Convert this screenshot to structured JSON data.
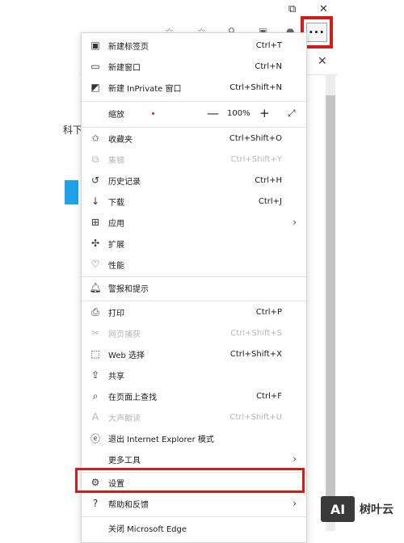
{
  "window_controls": {
    "restore": "⧉",
    "close": "✕"
  },
  "tab": {
    "close": "✕"
  },
  "toolbar": {
    "more_button": "···",
    "icons": [
      "star-icon",
      "favorites-icon",
      "extensions-icon",
      "collections-icon",
      "profile-icon"
    ],
    "icon_glyphs": [
      "☆",
      "☆",
      "⚲",
      "▣",
      "●"
    ]
  },
  "page": {
    "edge_text": "科下"
  },
  "menu": {
    "items": [
      {
        "icon": "new-tab-icon",
        "glyph": "▣",
        "label": "新建标签页",
        "shortcut": "Ctrl+T"
      },
      {
        "icon": "new-window-icon",
        "glyph": "▭",
        "label": "新建窗口",
        "shortcut": "Ctrl+N"
      },
      {
        "icon": "inprivate-icon",
        "glyph": "◩",
        "label": "新建 InPrivate 窗口",
        "shortcut": "Ctrl+Shift+N"
      }
    ],
    "zoom": {
      "label": "缩放",
      "minus": "—",
      "value": "100%",
      "plus": "+",
      "fullscreen": "⤢"
    },
    "items2": [
      {
        "icon": "favorites-icon",
        "glyph": "✩",
        "label": "收藏夹",
        "shortcut": "Ctrl+Shift+O",
        "disabled": false
      },
      {
        "icon": "collections-icon",
        "glyph": "⧉",
        "label": "集锦",
        "shortcut": "Ctrl+Shift+Y",
        "disabled": true
      },
      {
        "icon": "history-icon",
        "glyph": "↺",
        "label": "历史记录",
        "shortcut": "Ctrl+H",
        "disabled": false
      },
      {
        "icon": "download-icon",
        "glyph": "↓",
        "label": "下载",
        "shortcut": "Ctrl+J",
        "disabled": false
      },
      {
        "icon": "apps-icon",
        "glyph": "⊞",
        "label": "应用",
        "arrow": "›"
      },
      {
        "icon": "extensions-icon",
        "glyph": "✣",
        "label": "扩展"
      },
      {
        "icon": "performance-icon",
        "glyph": "♡",
        "label": "性能"
      }
    ],
    "alerts": {
      "icon": "bell-icon",
      "glyph": "🔔︎",
      "label": "警报和提示"
    },
    "items3": [
      {
        "icon": "print-icon",
        "glyph": "⎙",
        "label": "打印",
        "shortcut": "Ctrl+P",
        "disabled": false
      },
      {
        "icon": "web-capture-icon",
        "glyph": "✂",
        "label": "网页捕获",
        "shortcut": "Ctrl+Shift+S",
        "disabled": true
      },
      {
        "icon": "web-select-icon",
        "glyph": "⬚",
        "label": "Web 选择",
        "shortcut": "Ctrl+Shift+X",
        "disabled": false
      },
      {
        "icon": "share-icon",
        "glyph": "⇪",
        "label": "共享",
        "shortcut": "",
        "disabled": false
      },
      {
        "icon": "find-icon",
        "glyph": "⌕",
        "label": "在页面上查找",
        "shortcut": "Ctrl+F",
        "disabled": false
      },
      {
        "icon": "read-aloud-icon",
        "glyph": "A",
        "label": "大声朗读",
        "shortcut": "Ctrl+Shift+U",
        "disabled": true
      },
      {
        "icon": "ie-mode-icon",
        "glyph": "ⓔ",
        "label": "退出 Internet Explorer 模式",
        "shortcut": "",
        "disabled": false
      },
      {
        "icon": "",
        "glyph": "",
        "label": "更多工具",
        "arrow": "›",
        "disabled": false
      }
    ],
    "settings": {
      "icon": "gear-icon",
      "glyph": "⚙",
      "label": "设置"
    },
    "help": {
      "icon": "help-icon",
      "glyph": "?",
      "label": "帮助和反馈",
      "arrow": "›"
    },
    "close_edge": {
      "label": "关闭 Microsoft Edge"
    }
  },
  "watermark": {
    "logo": "AI",
    "text": "树叶云"
  },
  "colors": {
    "highlight": "#d11c1c",
    "accent": "#1fa3e8"
  }
}
